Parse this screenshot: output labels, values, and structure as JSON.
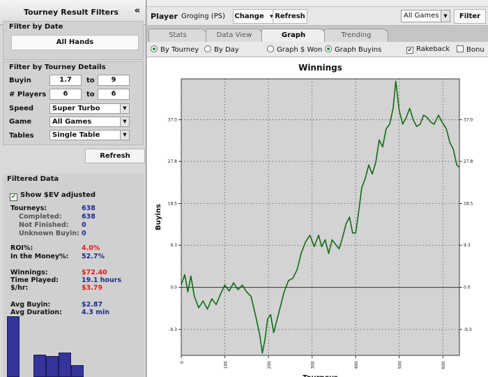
{
  "left_panel": {
    "title": "Tourney Result Filters",
    "collapse_icon": "«",
    "filter_by_date": {
      "heading": "Filter by Date",
      "all_hands_button": "All Hands"
    },
    "filter_by_details": {
      "heading": "Filter by Tourney Details",
      "buyin_label": "Buyin",
      "buyin_min": "1.7",
      "to1": "to",
      "buyin_max": "9",
      "players_label": "# Players",
      "players_min": "6",
      "to2": "to",
      "players_max": "6",
      "speed_label": "Speed",
      "speed_value": "Super Turbo",
      "game_label": "Game",
      "game_value": "All Games",
      "tables_label": "Tables",
      "tables_value": "Single Table"
    },
    "refresh_button": "Refresh",
    "filtered_data": {
      "heading": "Filtered Data",
      "show_ev_label": "Show $EV adjusted",
      "show_ev_checked": true,
      "stats": {
        "tourneys_label": "Tourneys:",
        "tourneys": "638",
        "completed_label": "Completed:",
        "completed": "638",
        "not_finished_label": "Not Finished:",
        "not_finished": "0",
        "unknown_label": "Unknown Buyin:",
        "unknown": "0",
        "roi_label": "ROI%:",
        "roi": "4.0%",
        "itm_label": "In the Money%:",
        "itm": "52.7%",
        "winnings_label": "Winnings:",
        "winnings": "$72.40",
        "time_label": "Time Played:",
        "time": "19.1 hours",
        "hr_label": "$/hr:",
        "hr": "$3.79",
        "avg_buyin_label": "Avg Buyin:",
        "avg_buyin": "$2.87",
        "avg_duration_label": "Avg Duration:",
        "avg_duration": "4.3 min"
      },
      "histogram_bars": [
        0.95,
        0.0,
        0.35,
        0.33,
        0.38,
        0.19
      ]
    }
  },
  "toolbar": {
    "player_label": "Player",
    "player_name": "Groging (PS)",
    "change_button": "Change",
    "change_arrow": "▾",
    "refresh_button": "Refresh",
    "games_select": "All Games",
    "filter_button": "Filter"
  },
  "tabs": [
    "Stats",
    "Data View",
    "Graph",
    "Trending"
  ],
  "active_tab": "Graph",
  "options": {
    "by_tourney": "By Tourney",
    "by_day": "By Day",
    "graph_won": "Graph $ Won",
    "graph_buyins": "Graph Buyins",
    "rakeback": "Rakeback",
    "bonus": "Bonu",
    "selected_period": "By Tourney",
    "selected_graph": "Graph Buyins",
    "rakeback_checked": true,
    "bonus_checked": false
  },
  "chart_data": {
    "type": "line",
    "title": "Winnings",
    "xlabel": "Tourneys",
    "ylabel": "Buyins",
    "xlim": [
      0,
      638
    ],
    "ylim": [
      -15,
      46
    ],
    "x_ticks": [
      "0",
      "100",
      "200",
      "300",
      "400",
      "500",
      "600"
    ],
    "y_ticks": [
      "-9.3",
      "0.0",
      "9.3",
      "18.5",
      "27.8",
      "37.0"
    ],
    "y_tick_values": [
      -9.3,
      0.0,
      9.3,
      18.5,
      27.8,
      37.0
    ],
    "grid": true,
    "line_color": "#0e6b12",
    "series": [
      {
        "points": [
          [
            0,
            0.6
          ],
          [
            8,
            2.8
          ],
          [
            15,
            -1.0
          ],
          [
            22,
            2.5
          ],
          [
            30,
            -2.0
          ],
          [
            40,
            -4.5
          ],
          [
            50,
            -3.0
          ],
          [
            60,
            -4.8
          ],
          [
            70,
            -2.5
          ],
          [
            80,
            -3.8
          ],
          [
            90,
            -1.5
          ],
          [
            100,
            0.5
          ],
          [
            110,
            -0.8
          ],
          [
            120,
            1.0
          ],
          [
            130,
            -0.5
          ],
          [
            140,
            0.5
          ],
          [
            150,
            -1.0
          ],
          [
            160,
            -2.0
          ],
          [
            170,
            -6.0
          ],
          [
            180,
            -10.5
          ],
          [
            186,
            -14.5
          ],
          [
            192,
            -11.5
          ],
          [
            198,
            -7.0
          ],
          [
            205,
            -6.0
          ],
          [
            212,
            -10.0
          ],
          [
            220,
            -7.0
          ],
          [
            228,
            -4.0
          ],
          [
            236,
            -1.0
          ],
          [
            246,
            1.5
          ],
          [
            256,
            2.0
          ],
          [
            266,
            4.0
          ],
          [
            275,
            7.5
          ],
          [
            285,
            10.0
          ],
          [
            295,
            11.5
          ],
          [
            305,
            9.0
          ],
          [
            315,
            11.5
          ],
          [
            322,
            9.0
          ],
          [
            330,
            10.5
          ],
          [
            338,
            7.5
          ],
          [
            346,
            10.5
          ],
          [
            354,
            9.5
          ],
          [
            362,
            8.5
          ],
          [
            370,
            11.0
          ],
          [
            378,
            14.0
          ],
          [
            386,
            15.5
          ],
          [
            393,
            12.0
          ],
          [
            400,
            12.0
          ],
          [
            406,
            16.0
          ],
          [
            414,
            22.0
          ],
          [
            422,
            24.0
          ],
          [
            430,
            27.0
          ],
          [
            438,
            25.0
          ],
          [
            446,
            27.5
          ],
          [
            454,
            32.5
          ],
          [
            462,
            31.0
          ],
          [
            470,
            35.0
          ],
          [
            478,
            36.0
          ],
          [
            486,
            39.5
          ],
          [
            492,
            45.5
          ],
          [
            500,
            39.0
          ],
          [
            508,
            36.0
          ],
          [
            516,
            37.5
          ],
          [
            524,
            39.5
          ],
          [
            532,
            37.0
          ],
          [
            540,
            35.5
          ],
          [
            548,
            36.0
          ],
          [
            556,
            38.0
          ],
          [
            564,
            37.5
          ],
          [
            572,
            36.5
          ],
          [
            580,
            36.0
          ],
          [
            590,
            38.0
          ],
          [
            598,
            36.5
          ],
          [
            608,
            35.0
          ],
          [
            616,
            32.0
          ],
          [
            624,
            30.5
          ],
          [
            632,
            27.0
          ],
          [
            638,
            26.5
          ]
        ]
      }
    ]
  }
}
